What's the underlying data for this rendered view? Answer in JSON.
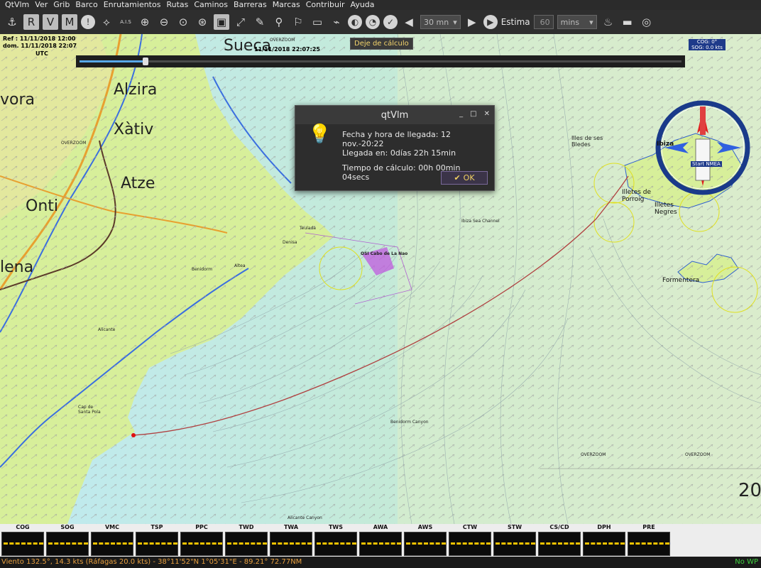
{
  "menu": [
    "QtVlm",
    "Ver",
    "Grib",
    "Barco",
    "Enrutamientos",
    "Rutas",
    "Caminos",
    "Barreras",
    "Marcas",
    "Contribuir",
    "Ayuda"
  ],
  "toolbar": {
    "step_select": "30 mn",
    "estima_label": "Estima",
    "estima_value": "60",
    "units_select": "mins",
    "ais_label": "A.I.S"
  },
  "timeline": {
    "ref_line1": "Ref : 11/11/2018 12:00",
    "ref_line2": "dom. 11/11/2018 22:07",
    "tz": "UTC",
    "current": "11/11/2018 22:07:25",
    "stop_button": "Deje de cálculo",
    "progress": 0.11
  },
  "map_labels": {
    "sueca": "Sueca",
    "alzira": "Alzira",
    "xativa": "Xàtiv",
    "atze": "Atze",
    "onti": "Onti",
    "vora": "vora",
    "lena": "lena",
    "ibiza": "Ibiza",
    "formentera": "Formentera",
    "illetes_porroig": "Illetes de Porroig",
    "illetes_negres": "Illetes Negres",
    "illes_bledes": "Illes de ses Bledes",
    "overzoom": "OVERZOOM",
    "cabo_la_nao": "OSI Cabo de La Nao",
    "benidorm": "Benidorm",
    "altea": "Altea",
    "teulada": "Teulada",
    "denisa": "Denisa",
    "alicante": "Alicante",
    "santa_pola": "Cap de Santa Pola",
    "benidorm_canyon": "Benidorm Canyon",
    "ibiza_channel": "Ibiza Sea Channel",
    "alicante_canyon": "Alicante Canyon",
    "big_20": "20"
  },
  "dialog": {
    "title": "qtVlm",
    "arrival": "Fecha y hora de llegada: 12 nov.-20:22",
    "duration": "Llegada en: 0días 22h 15min",
    "calc_time": "Tiempo de cálculo: 00h 00min 04secs",
    "ok": "OK"
  },
  "compass": {
    "cog": "COG: 0°",
    "sog": "SOG: 0.0 kts",
    "label": "TWA",
    "start": "Start NMEA"
  },
  "instruments": [
    "COG",
    "SOG",
    "VMC",
    "TSP",
    "PPC",
    "TWD",
    "TWA",
    "TWS",
    "AWA",
    "AWS",
    "CTW",
    "STW",
    "CS/CD",
    "DPH",
    "PRE"
  ],
  "status": {
    "left": "Viento 132.5°, 14.3 kts (Ráfagas 20.0 kts)  -  38°11'52\"N  1°05'31\"E - 89.21°   72.77NM",
    "right": "No WP"
  },
  "colors": {
    "route": "#b04040",
    "sea": "#b7e3ec",
    "land": "#d8f0a0",
    "instrument_dash": "#f2c200"
  }
}
